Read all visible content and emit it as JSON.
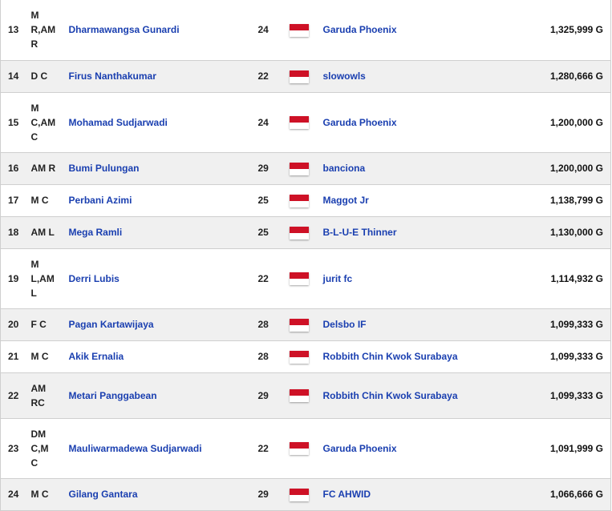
{
  "colors": {
    "link": "#1a3fb0",
    "row_alt": "#f0f0f0",
    "border": "#cfcfcf",
    "flag_red": "#ce1126",
    "flag_white": "#ffffff"
  },
  "rows": [
    {
      "rank": "13",
      "pos": [
        "M",
        "R,AM",
        "R"
      ],
      "name": "Dharmawangsa Gunardi",
      "age": "24",
      "flag": "indonesia-flag-icon",
      "team": "Garuda Phoenix",
      "value": "1,325,999 G"
    },
    {
      "rank": "14",
      "pos": [
        "D C"
      ],
      "name": "Firus Nanthakumar",
      "age": "22",
      "flag": "indonesia-flag-icon",
      "team": "slowowls",
      "value": "1,280,666 G"
    },
    {
      "rank": "15",
      "pos": [
        "M",
        "C,AM",
        "C"
      ],
      "name": "Mohamad Sudjarwadi",
      "age": "24",
      "flag": "indonesia-flag-icon",
      "team": "Garuda Phoenix",
      "value": "1,200,000 G"
    },
    {
      "rank": "16",
      "pos": [
        "AM R"
      ],
      "name": "Bumi Pulungan",
      "age": "29",
      "flag": "indonesia-flag-icon",
      "team": "banciona",
      "value": "1,200,000 G"
    },
    {
      "rank": "17",
      "pos": [
        "M C"
      ],
      "name": "Perbani Azimi",
      "age": "25",
      "flag": "indonesia-flag-icon",
      "team": "Maggot Jr",
      "value": "1,138,799 G"
    },
    {
      "rank": "18",
      "pos": [
        "AM L"
      ],
      "name": "Mega Ramli",
      "age": "25",
      "flag": "indonesia-flag-icon",
      "team": "B-L-U-E Thinner",
      "value": "1,130,000 G"
    },
    {
      "rank": "19",
      "pos": [
        "M",
        "L,AM",
        "L"
      ],
      "name": "Derri Lubis",
      "age": "22",
      "flag": "indonesia-flag-icon",
      "team": "jurit fc",
      "value": "1,114,932 G"
    },
    {
      "rank": "20",
      "pos": [
        "F C"
      ],
      "name": "Pagan Kartawijaya",
      "age": "28",
      "flag": "indonesia-flag-icon",
      "team": "Delsbo IF",
      "value": "1,099,333 G"
    },
    {
      "rank": "21",
      "pos": [
        "M C"
      ],
      "name": "Akik Ernalia",
      "age": "28",
      "flag": "indonesia-flag-icon",
      "team": "Robbith Chin Kwok Surabaya",
      "value": "1,099,333 G"
    },
    {
      "rank": "22",
      "pos": [
        "AM",
        "RC"
      ],
      "name": "Metari Panggabean",
      "age": "29",
      "flag": "indonesia-flag-icon",
      "team": "Robbith Chin Kwok Surabaya",
      "value": "1,099,333 G"
    },
    {
      "rank": "23",
      "pos": [
        "DM",
        "C,M",
        "C"
      ],
      "name": "Mauliwarmadewa Sudjarwadi",
      "age": "22",
      "flag": "indonesia-flag-icon",
      "team": "Garuda Phoenix",
      "value": "1,091,999 G"
    },
    {
      "rank": "24",
      "pos": [
        "M C"
      ],
      "name": "Gilang Gantara",
      "age": "29",
      "flag": "indonesia-flag-icon",
      "team": "FC AHWID",
      "value": "1,066,666 G"
    }
  ]
}
